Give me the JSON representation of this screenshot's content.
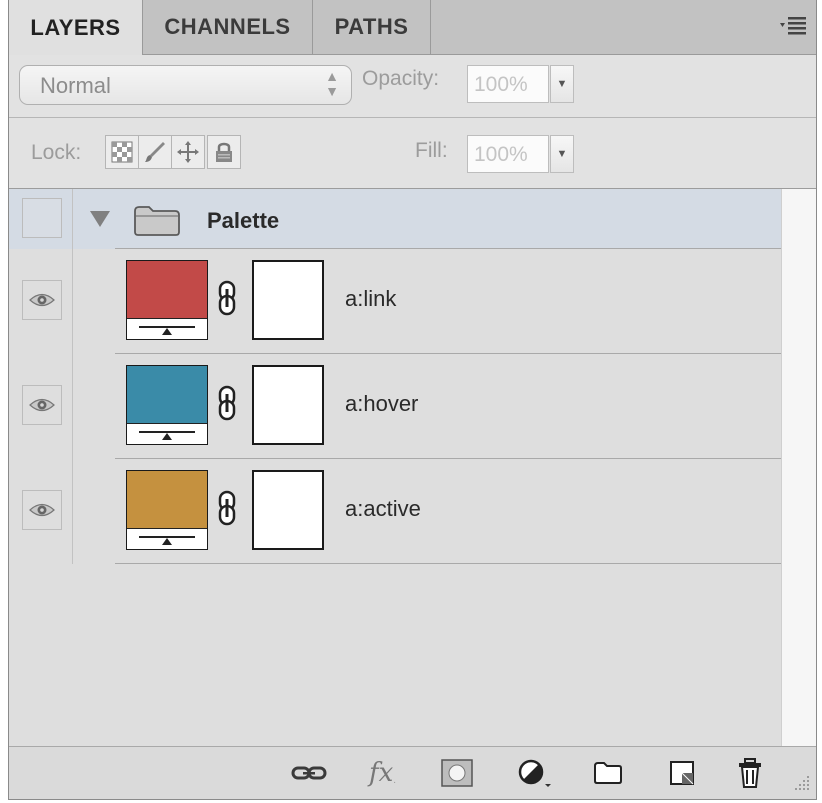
{
  "tabs": [
    {
      "label": "LAYERS",
      "active": true
    },
    {
      "label": "CHANNELS",
      "active": false
    },
    {
      "label": "PATHS",
      "active": false
    }
  ],
  "panel_menu_icon": "panel-menu-icon",
  "blend_mode": {
    "value": "Normal"
  },
  "opacity": {
    "label": "Opacity:",
    "value": "100%"
  },
  "lock": {
    "label": "Lock:",
    "icons": [
      "lock-transparent-pixels-icon",
      "lock-image-pixels-icon",
      "lock-position-icon",
      "lock-all-icon"
    ]
  },
  "fill": {
    "label": "Fill:",
    "value": "100%"
  },
  "group": {
    "name": "Palette",
    "expanded": true,
    "visible": false
  },
  "layers": [
    {
      "name": "a:link",
      "color": "#c24a48",
      "visible": true
    },
    {
      "name": "a:hover",
      "color": "#3a8ba8",
      "visible": true
    },
    {
      "name": "a:active",
      "color": "#c5913f",
      "visible": true
    }
  ],
  "toolbar_icons": [
    "link-layers-icon",
    "fx-icon",
    "add-mask-icon",
    "adjustment-layer-icon",
    "new-group-icon",
    "new-layer-icon",
    "trash-icon"
  ]
}
